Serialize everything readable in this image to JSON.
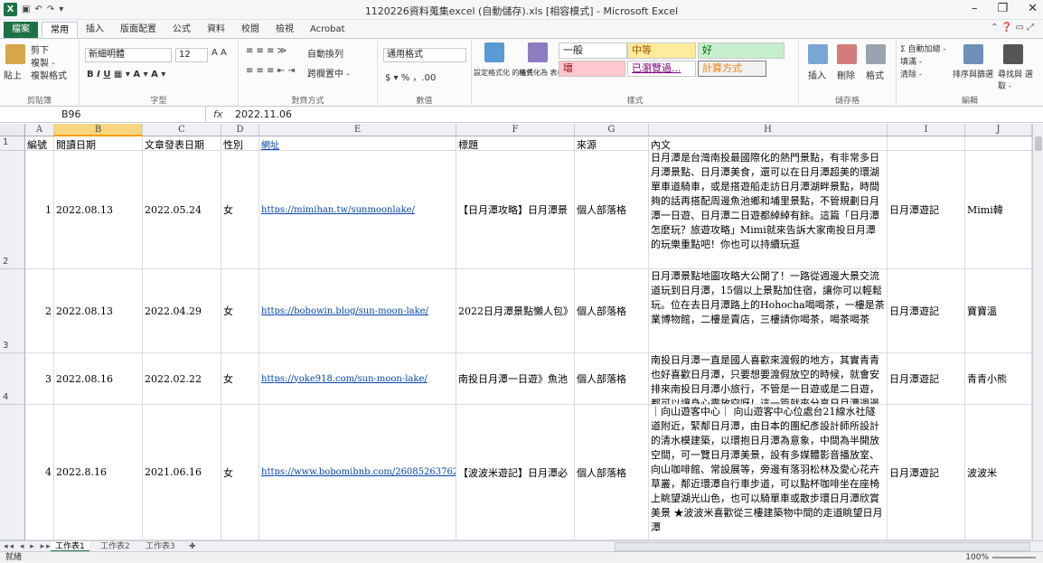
{
  "window": {
    "title": "1120226資料蒐集excel (自動儲存).xls [相容模式] - Microsoft Excel",
    "min": "–",
    "max": "❐",
    "close": "✕"
  },
  "ribbon_tabs": [
    "檔案",
    "常用",
    "插入",
    "版面配置",
    "公式",
    "資料",
    "校閱",
    "檢視",
    "Acrobat"
  ],
  "ribbon": {
    "clipboard": {
      "paste": "貼上",
      "cut": "剪下",
      "copy": "複製 -",
      "format_painter": "複製格式",
      "label": "剪貼簿"
    },
    "font": {
      "name": "新細明體",
      "size": "12",
      "label": "字型"
    },
    "alignment": {
      "wrap": "自動換列",
      "merge": "跨欄置中 -",
      "label": "對齊方式"
    },
    "number": {
      "format": "通用格式",
      "label": "數值"
    },
    "styles": {
      "conditional": "設定格式化 的條件 -",
      "as_table": "格式化為 表格 -",
      "normal": "一般",
      "neutral": "中等",
      "good": "好",
      "bad": "壞",
      "followed_link": "已瀏覽過...",
      "calculation": "計算方式",
      "label": "樣式"
    },
    "cells": {
      "insert": "插入",
      "delete": "刪除",
      "format": "格式",
      "label": "儲存格"
    },
    "editing": {
      "autosum": "Σ 自動加總 -",
      "fill": "填滿 -",
      "clear": "清除 -",
      "sort": "排序與篩選",
      "find": "尋找與 選取 -",
      "label": "編輯"
    }
  },
  "formula_bar": {
    "name_box": "B96",
    "fx": "fx",
    "value": "2022.11.06"
  },
  "columns": [
    "A",
    "B",
    "C",
    "D",
    "E",
    "F",
    "G",
    "H",
    "I",
    "J"
  ],
  "selected_column": "B",
  "rows": [
    {
      "num": "1",
      "cells": [
        "編號",
        "閱讀日期",
        "文章發表日期",
        "性別",
        "網址",
        "標題",
        "來源",
        "內文",
        "",
        ""
      ]
    },
    {
      "num": "2",
      "cells": [
        "1",
        "2022.08.13",
        "2022.05.24",
        "女",
        "https://mimihan.tw/sunmoonlake/",
        "【日月潭攻略】日月潭景",
        "個人部落格",
        "日月潭是台灣南投最國際化的熱門景點，有非常多日月潭景點、日月潭美食，還可以在日月潭超美的環湖單車道騎車，或是搭遊船走訪日月潭湖畔景點，時間夠的話再搭配周邊魚池鄉和埔里景點，不管規劃日月潭一日遊、日月潭二日遊都綽綽有餘。這篇「日月潭怎麼玩？旅遊攻略」Mimi就來告訴大家南投日月潭的玩樂重點吧！你也可以持續玩逛",
        "日月潭遊記",
        "Mimi韓"
      ]
    },
    {
      "num": "3",
      "cells": [
        "2",
        "2022.08.13",
        "2022.04.29",
        "女",
        "https://bobowin.blog/sun-moon-lake/",
        "2022日月潭景點懶人包》",
        "個人部落格",
        "日月潭景點地圖攻略大公開了！一路從週邊大景交流道玩到日月潭，15個以上景點加住宿，讓你可以輕鬆玩。位在去日月潭路上的Hohocha喝喝茶，一樓是茶業博物館，二樓是賣店，三樓請你喝茶，喝茶喝茶",
        "日月潭遊記",
        "寶寶溫"
      ]
    },
    {
      "num": "4",
      "cells": [
        "3",
        "2022.08.16",
        "2022.02.22",
        "女",
        "https://yoke918.com/sun-moon-lake/",
        "南投日月潭一日遊》魚池",
        "個人部落格",
        "南投日月潭一直是國人喜歡來渡假的地方，其實青青也好喜歡日月潭，只要想要渡假放空的時候，就會安排來南投日月潭小旅行，不管是一日遊或是二日遊，都可以讓身心靈放空呀！這一篇就來分享日月潭週邊的必玩景點，以及青青住過還不錯的飯店、民宿給大家。放假如果想來日月潭",
        "日月潭遊記",
        "青青小熊"
      ]
    },
    {
      "num": "",
      "cells": [
        "4",
        "2022.8.16",
        "2021.06.16",
        "女",
        "https://www.bobomibnb.com/26085263762852",
        "【波波米遊記】日月潭必",
        "個人部落格",
        "｜向山遊客中心｜ 向山遊客中心位處台21線水社隧道附近，緊鄰日月潭，由日本的團紀彥設計師所設計的清水模建築，以環抱日月潭為意象，中間為半開放空間，可一覽日月潭美景，設有多媒體影音播放室、向山咖啡館、常設展等，旁邊有落羽松林及愛心花卉草叢，鄰近環潭自行車步道，可以點杯咖啡坐在座椅上眺望湖光山色，也可以騎單車或散步環日月潭欣賞美景 ★波波米喜歡從三樓建築物中間的走道眺望日月潭",
        "日月潭遊記",
        "波波米"
      ]
    }
  ],
  "sheets": [
    "工作表1",
    "工作表2",
    "工作表3"
  ],
  "status": {
    "mode": "就緒",
    "zoom": "100%"
  }
}
